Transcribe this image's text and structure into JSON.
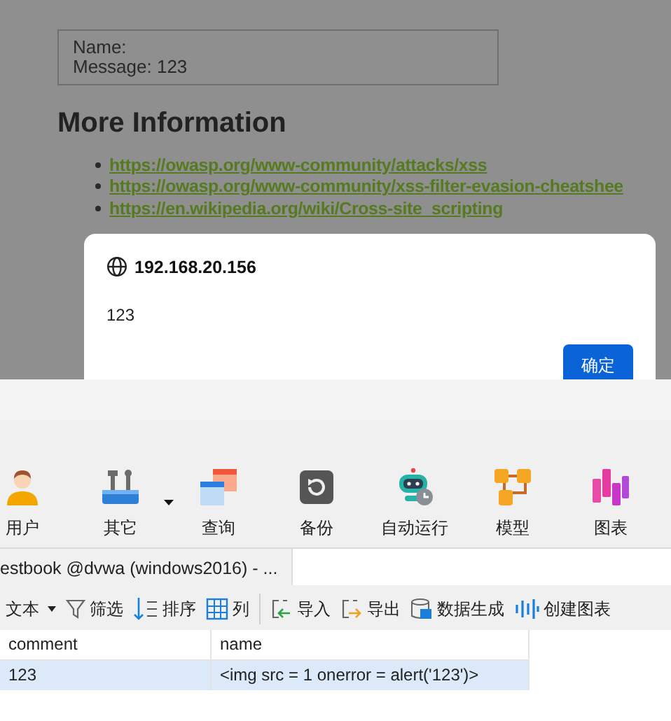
{
  "page": {
    "entry_lines": [
      "Name:",
      "Message: 123"
    ],
    "heading": "More Information",
    "links": [
      "https://owasp.org/www-community/attacks/xss",
      "https://owasp.org/www-community/xss-filter-evasion-cheatshee",
      "https://en.wikipedia.org/wiki/Cross-site_scripting"
    ]
  },
  "alert": {
    "host": "192.168.20.156",
    "message": "123",
    "button": "确定"
  },
  "toolbar": [
    {
      "label": "用户",
      "has_menu": false
    },
    {
      "label": "其它",
      "has_menu": true
    },
    {
      "label": "查询",
      "has_menu": false
    },
    {
      "label": "备份",
      "has_menu": false
    },
    {
      "label": "自动运行",
      "has_menu": false
    },
    {
      "label": "模型",
      "has_menu": false
    },
    {
      "label": "图表",
      "has_menu": false
    }
  ],
  "tab": {
    "label": "estbook @dvwa (windows2016) - ..."
  },
  "grid_toolbar": [
    {
      "label": "文本",
      "has_menu": true
    },
    {
      "label": "筛选",
      "has_menu": false
    },
    {
      "label": "排序",
      "has_menu": false
    },
    {
      "label": "列",
      "has_menu": false
    },
    {
      "label": "导入",
      "has_menu": false
    },
    {
      "label": "导出",
      "has_menu": false
    },
    {
      "label": "数据生成",
      "has_menu": false
    },
    {
      "label": "创建图表",
      "has_menu": false
    }
  ],
  "grid": {
    "columns": [
      "comment",
      "name"
    ],
    "rows": [
      {
        "cells": [
          "123",
          "<img src = 1 onerror = alert('123')>"
        ],
        "selected": true
      }
    ]
  }
}
